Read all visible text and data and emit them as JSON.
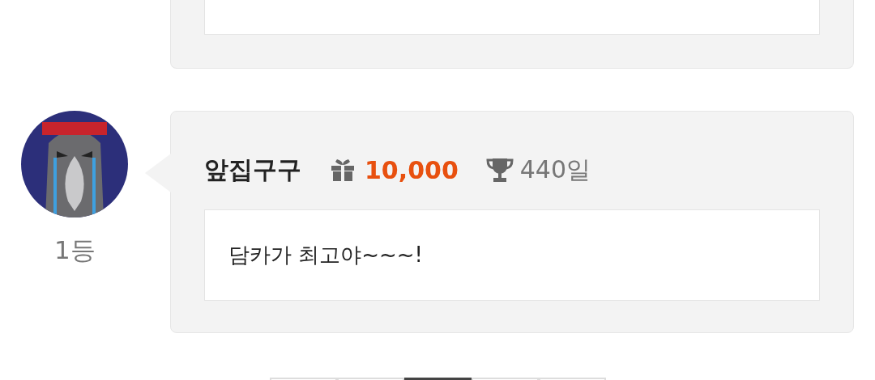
{
  "comment": {
    "rank": "1등",
    "author": "앞집구구",
    "gift": "10,000",
    "days": "440일",
    "text": "담카가 최고야~~~!"
  },
  "pagination": [
    {
      "selected": false
    },
    {
      "selected": false
    },
    {
      "selected": true
    },
    {
      "selected": false
    },
    {
      "selected": false
    }
  ]
}
